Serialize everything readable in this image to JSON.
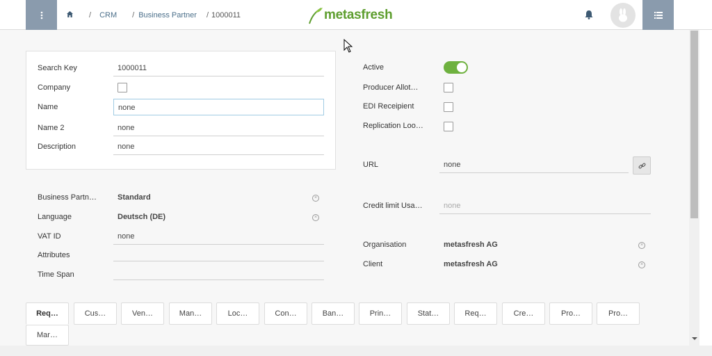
{
  "header": {
    "breadcrumb": {
      "crm": "CRM",
      "business_partner": "Business Partner",
      "record_id": "1000011"
    },
    "logo_text": "metasfresh",
    "icons": {
      "menu": "vertical-dots-icon",
      "home": "home-icon",
      "bell": "bell-icon",
      "avatar": "rabbit-avatar-icon",
      "side_menu": "list-menu-icon"
    }
  },
  "left_panel": {
    "search_key": {
      "label": "Search Key",
      "value": "1000011"
    },
    "company": {
      "label": "Company",
      "checked": false
    },
    "name": {
      "label": "Name",
      "value": "none"
    },
    "name2": {
      "label": "Name 2",
      "value": "none"
    },
    "description": {
      "label": "Description",
      "value": "none"
    }
  },
  "left_lower": {
    "bp_group": {
      "label": "Business Partn…",
      "value": "Standard"
    },
    "language": {
      "label": "Language",
      "value": "Deutsch (DE)"
    },
    "vat_id": {
      "label": "VAT ID",
      "value": "none"
    },
    "attributes": {
      "label": "Attributes",
      "value": ""
    },
    "time_span": {
      "label": "Time Span",
      "value": ""
    }
  },
  "right": {
    "active": {
      "label": "Active",
      "on": true
    },
    "producer_allot": {
      "label": "Producer Allot…",
      "checked": false
    },
    "edi_recipient": {
      "label": "EDI Receipient",
      "checked": false
    },
    "replication_lookup": {
      "label": "Replication Loo…",
      "checked": false
    },
    "url": {
      "label": "URL",
      "value": "none"
    },
    "credit_limit": {
      "label": "Credit limit Usa…",
      "value": "none"
    },
    "organisation": {
      "label": "Organisation",
      "value": "metasfresh AG"
    },
    "client": {
      "label": "Client",
      "value": "metasfresh AG"
    }
  },
  "tabs": [
    "Req…",
    "Cus…",
    "Ven…",
    "Man…",
    "Loc…",
    "Con…",
    "Ban…",
    "Prin…",
    "Stat…",
    "Req…",
    "Cre…",
    "Pro…",
    "Pro…",
    "Mar…"
  ],
  "colors": {
    "accent_green": "#6eb13f",
    "header_button": "#8a9bad",
    "link": "#4b6f8a"
  }
}
